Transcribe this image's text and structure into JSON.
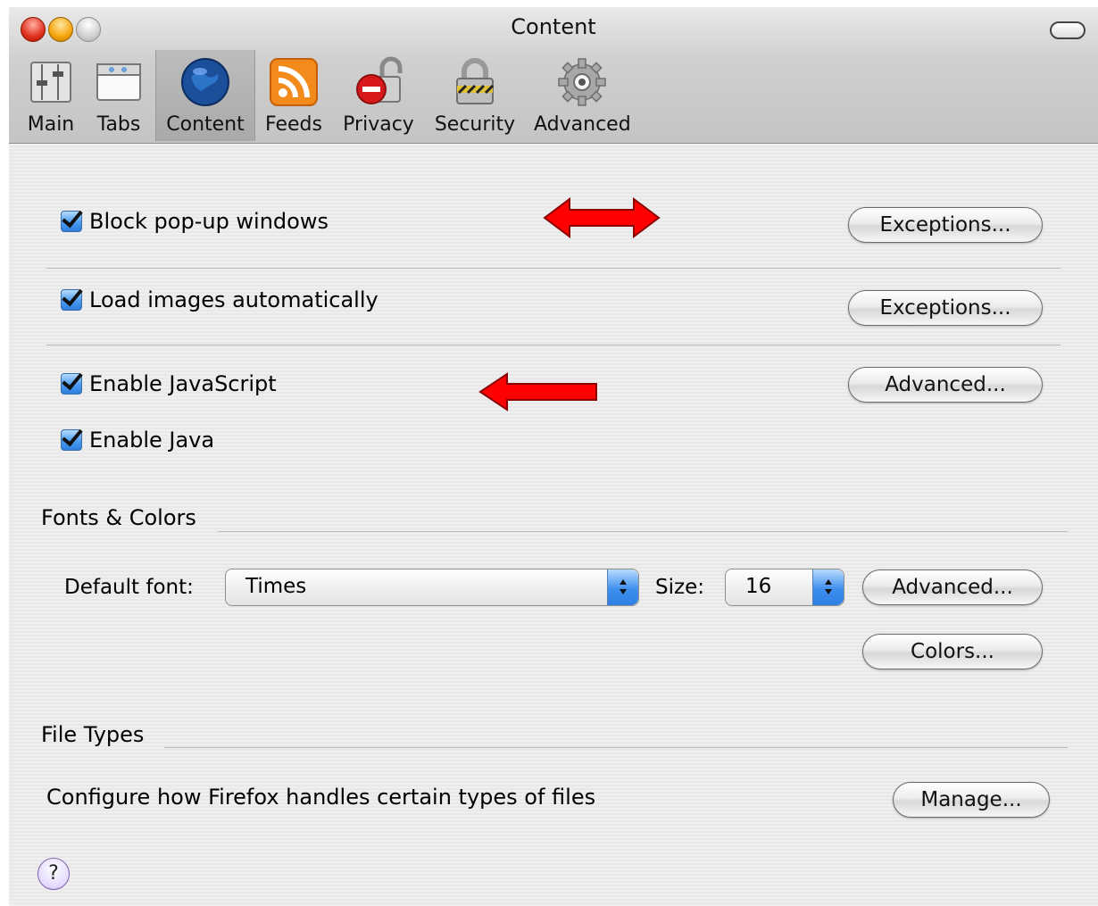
{
  "window": {
    "title": "Content"
  },
  "toolbar": {
    "items": [
      {
        "label": "Main",
        "icon": "main-icon"
      },
      {
        "label": "Tabs",
        "icon": "tabs-icon"
      },
      {
        "label": "Content",
        "icon": "globe-icon",
        "selected": true
      },
      {
        "label": "Feeds",
        "icon": "rss-feed-icon"
      },
      {
        "label": "Privacy",
        "icon": "privacy-lock-icon"
      },
      {
        "label": "Security",
        "icon": "padlock-icon"
      },
      {
        "label": "Advanced",
        "icon": "gear-icon"
      }
    ]
  },
  "content": {
    "block_popups": {
      "label": "Block pop-up windows",
      "checked": true,
      "button": "Exceptions..."
    },
    "load_images": {
      "label": "Load images automatically",
      "checked": true,
      "button": "Exceptions..."
    },
    "enable_js": {
      "label": "Enable JavaScript",
      "checked": true,
      "button": "Advanced..."
    },
    "enable_java": {
      "label": "Enable Java",
      "checked": true
    },
    "fonts": {
      "section_title": "Fonts & Colors",
      "default_font_label": "Default font:",
      "default_font_value": "Times",
      "size_label": "Size:",
      "size_value": "16",
      "advanced_button": "Advanced...",
      "colors_button": "Colors..."
    },
    "file_types": {
      "section_title": "File Types",
      "description": "Configure how Firefox handles certain types of files",
      "manage_button": "Manage..."
    },
    "help_label": "?"
  },
  "colors": {
    "annotation_arrow": "#ff0000",
    "checkbox_blue": "#3d8ff0"
  }
}
